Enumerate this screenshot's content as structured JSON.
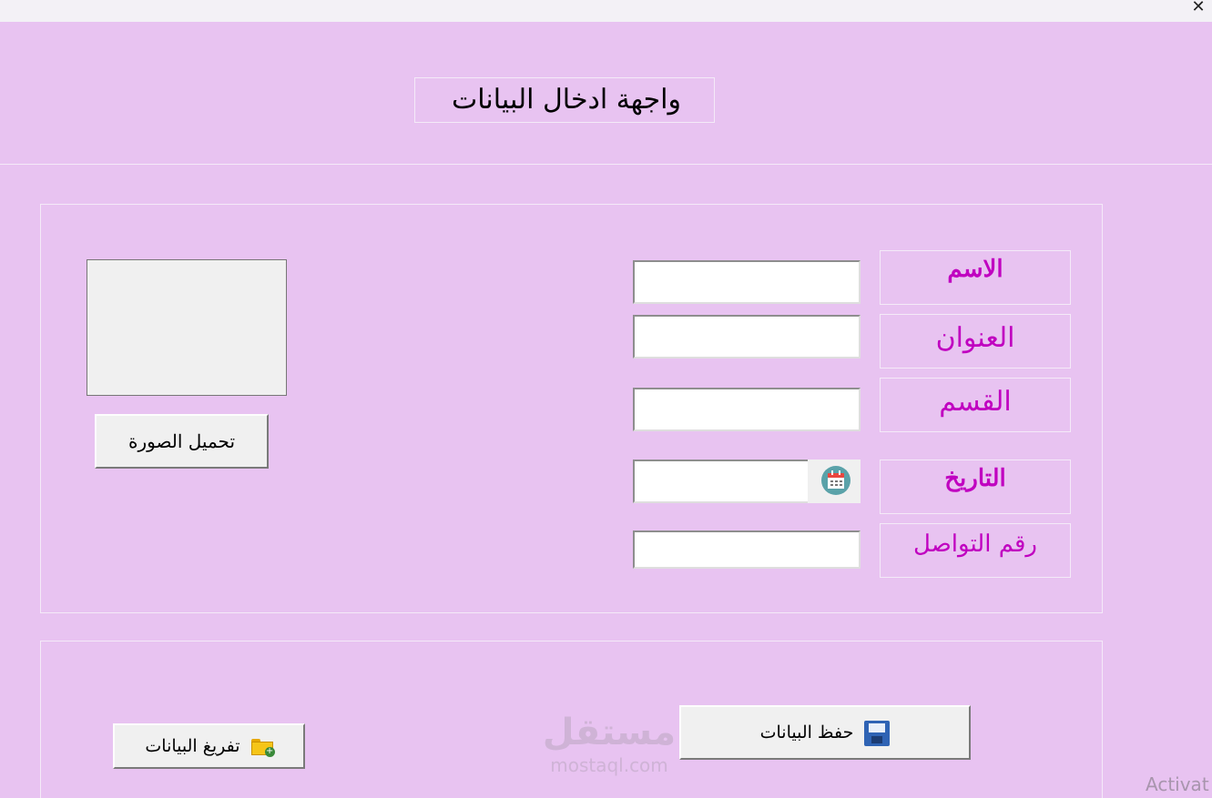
{
  "window": {
    "close_glyph": "✕"
  },
  "header": {
    "title": "واجهة ادخال البيانات"
  },
  "fields": {
    "name": {
      "label": "الاسم",
      "value": ""
    },
    "address": {
      "label": "العنوان",
      "value": ""
    },
    "section": {
      "label": "القسم",
      "value": ""
    },
    "date": {
      "label": "التاريخ",
      "value": ""
    },
    "contact": {
      "label": "رقم التواصل",
      "value": ""
    }
  },
  "photo": {
    "upload_label": "تحميل الصورة"
  },
  "actions": {
    "save_label": "حفظ البيانات",
    "clear_label": "تفريغ البيانات"
  },
  "icons": {
    "save": "floppy-disk-icon",
    "clear": "folder-add-icon",
    "date": "calendar-icon"
  },
  "watermark": {
    "arabic": "مستقل",
    "latin": "mostaql.com"
  },
  "os_overlay": {
    "text": "Activat"
  },
  "colors": {
    "background": "#e8c3f1",
    "label_text": "#c000c0",
    "titlebar": "#f3f1f6"
  }
}
